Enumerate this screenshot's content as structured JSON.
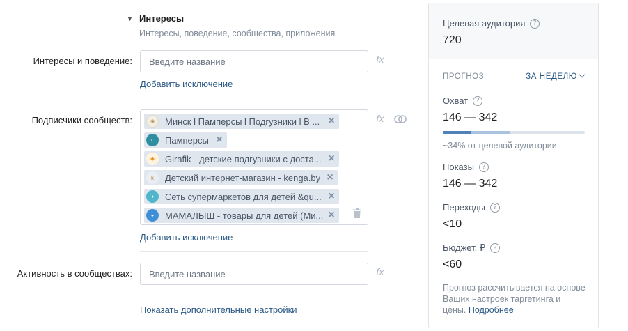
{
  "section": {
    "title": "Интересы",
    "subtitle": "Интересы, поведение, сообщества, приложения"
  },
  "interests": {
    "label": "Интересы и поведение:",
    "placeholder": "Введите название",
    "fx": "fx",
    "add_exclusion": "Добавить исключение"
  },
  "subscribers": {
    "label": "Подписчики сообществ:",
    "fx": "fx",
    "add_exclusion": "Добавить исключение",
    "communities": [
      {
        "name": "Минск l Памперсы l Подгузники l В ...",
        "avatar_color": "#f3efe6",
        "icon": "pampers-minsk-avatar-icon"
      },
      {
        "name": "Памперсы",
        "avatar_color": "#2f8fa1",
        "icon": "pampers-avatar-icon"
      },
      {
        "name": "Girafik - детские подгузники с доста...",
        "avatar_color": "#f5a623",
        "icon": "girafik-avatar-icon"
      },
      {
        "name": "Детский интернет-магазин - kenga.by",
        "avatar_color": "#e9eef4",
        "icon": "kenga-avatar-icon"
      },
      {
        "name": "Сеть супермаркетов для детей &qu...",
        "avatar_color": "#4fb7c9",
        "icon": "supermarket-avatar-icon"
      },
      {
        "name": "МАМАЛЫШ - товары для детей (Ми...",
        "avatar_color": "#3f8fd6",
        "icon": "mamalysh-avatar-icon"
      }
    ]
  },
  "activity": {
    "label": "Активность в сообществах:",
    "placeholder": "Введите название",
    "fx": "fx"
  },
  "more_settings": "Показать дополнительные настройки",
  "panel": {
    "audience_label": "Целевая аудитория",
    "audience_value": "720",
    "forecast_label": "ПРОГНОЗ",
    "period_label": "ЗА НЕДЕЛЮ",
    "reach_label": "Охват",
    "reach_value": "146 — 342",
    "reach_bar": {
      "low_pct": 20.3,
      "high_pct": 47.5
    },
    "reach_note": "~34% от целевой аудитории",
    "impressions_label": "Показы",
    "impressions_value": "146 — 342",
    "clicks_label": "Переходы",
    "clicks_value": "<10",
    "budget_label": "Бюджет, ₽",
    "budget_value": "<60",
    "footnote": "Прогноз рассчитывается на основе Ваших настроек таргетинга и цены.",
    "footnote_link": "Подробнее"
  },
  "colors": {
    "accent": "#2a5885",
    "token_bg": "#dfe6ee",
    "muted": "#818c99",
    "bar_fill": "#5181b8"
  }
}
